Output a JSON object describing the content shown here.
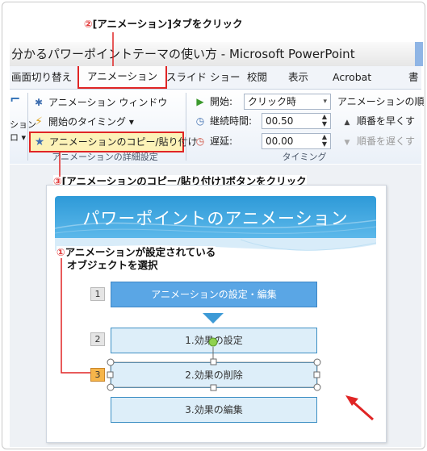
{
  "callouts": {
    "c2": {
      "num": "②",
      "text": "[アニメーション]タブをクリック"
    },
    "c3": {
      "num": "③",
      "text": "[アニメーションのコピー/貼り付け]ボタンをクリック"
    },
    "c1": {
      "num": "①",
      "line1": "アニメーションが設定されている",
      "line2": "オブジェクトを選択"
    }
  },
  "window": {
    "title": "分かるパワーポイントテーマの使い方 - Microsoft PowerPoint"
  },
  "tabs": [
    "画面切り替え",
    "アニメーション",
    "スライド ショー",
    "校閲",
    "表示",
    "Acrobat",
    "書"
  ],
  "ribbon": {
    "left_partial": {
      "line1": "ション",
      "line2": "ロ ▾"
    },
    "advanced": {
      "pane": "アニメーション ウィンドウ",
      "trigger": "開始のタイミング ▾",
      "painter": "アニメーションのコピー/貼り付け",
      "group_label": "アニメーションの詳細設定"
    },
    "timing": {
      "start_label": "開始:",
      "start_value": "クリック時",
      "duration_label": "継続時間:",
      "duration_value": "00.50",
      "delay_label": "遅延:",
      "delay_value": "00.00",
      "group_label": "タイミング"
    },
    "reorder": {
      "title": "アニメーションの順",
      "earlier": "順番を早くす",
      "later": "順番を遅くす"
    }
  },
  "slide": {
    "title": "パワーポイントのアニメーション",
    "steps": [
      {
        "num": "1",
        "label": "アニメーションの設定・編集"
      },
      {
        "num": "2",
        "label": "1.効果の設定"
      },
      {
        "num": "3",
        "label": "2.効果の削除"
      },
      {
        "num": "",
        "label": "3.効果の編集"
      }
    ]
  },
  "colors": {
    "callout_red": "#e02525",
    "header_blue": "#2e9ad8",
    "highlight_yellow": "#fcf2b8"
  }
}
